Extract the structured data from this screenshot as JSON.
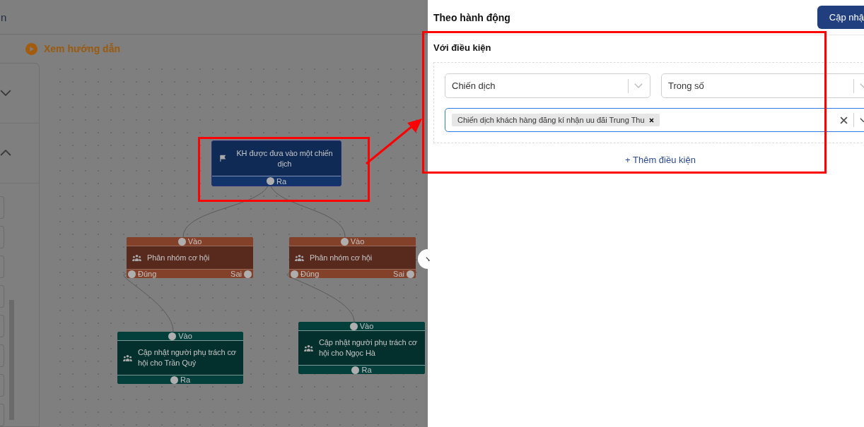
{
  "top_bar": {
    "title_fragment": "n"
  },
  "guide_link": {
    "label": "Xem hướng dẫn"
  },
  "flow": {
    "nodes": [
      {
        "kind": "trigger",
        "title": "KH được đưa vào một chiến dịch",
        "output": "Ra"
      },
      {
        "kind": "branch",
        "title": "Phân nhóm cơ hội",
        "input": "Vào",
        "true_output": "Đúng",
        "false_output": "Sai"
      },
      {
        "kind": "branch",
        "title": "Phân nhóm cơ hội",
        "input": "Vào",
        "true_output": "Đúng",
        "false_output": "Sai"
      },
      {
        "kind": "action",
        "title": "Cập nhật người phụ trách cơ hội cho Trần Quý",
        "input": "Vào",
        "output": "Ra"
      },
      {
        "kind": "action",
        "title": "Cập nhật người phụ trách cơ hội cho Ngọc Hà",
        "input": "Vào",
        "output": "Ra"
      }
    ]
  },
  "panel": {
    "title": "Theo hành động",
    "save_button": "Cập nhậ",
    "section_title": "Với điều kiện",
    "conditions": [
      {
        "field": "Chiến dịch",
        "operator": "Trong số",
        "values": [
          "Chiến dịch khách hàng đăng kí nhận uu đãi Trung Thu"
        ]
      }
    ],
    "add_condition": "+ Thêm điều kiện"
  }
}
